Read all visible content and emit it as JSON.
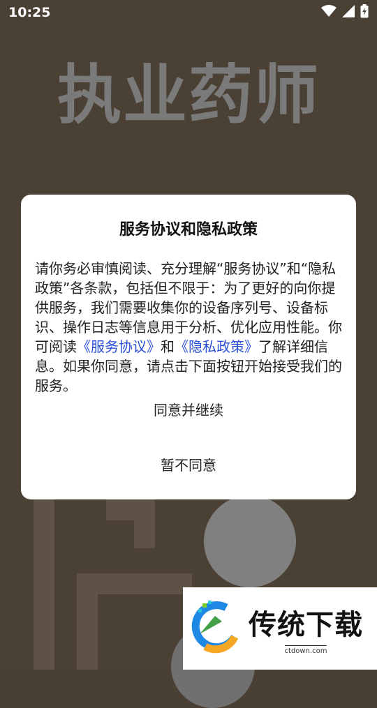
{
  "status_bar": {
    "time": "10:25"
  },
  "splash": {
    "title": "执业药师"
  },
  "dialog": {
    "title": "服务协议和隐私政策",
    "body_before": "请你务必审慎阅读、充分理解“服务协议”和“隐私政策”各条款，包括但不限于：为了更好的向你提供服务，我们需要收集你的设备序列号、设备标识、操作日志等信息用于分析、优化应用性能。你可阅读",
    "link_service": "《服务协议》",
    "connector": "和",
    "link_privacy": "《隐私政策》",
    "body_after": "了解详细信息。如果你同意，请点击下面按钮开始接受我们的服务。",
    "agree_label": "同意并继续",
    "decline_label": "暂不同意"
  },
  "watermark": {
    "name": "传统下载",
    "url": "ctdown.com"
  },
  "colors": {
    "link": "#2a4fd6",
    "background": "#4b4034"
  },
  "icons": [
    "wifi-icon",
    "signal-icon",
    "battery-icon"
  ]
}
